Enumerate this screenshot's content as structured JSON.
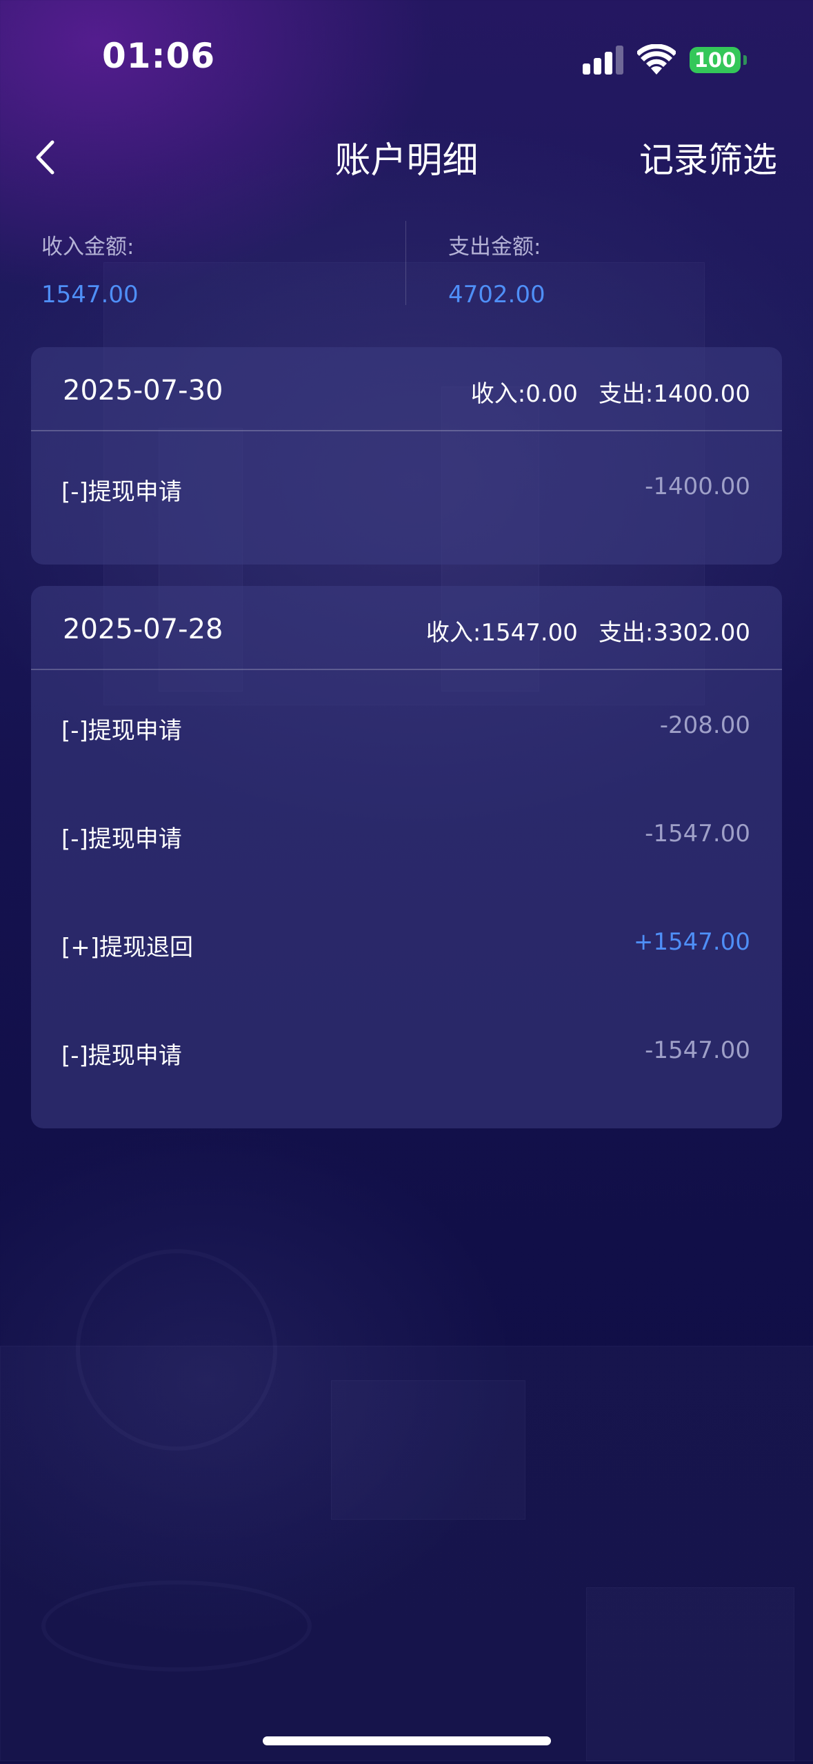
{
  "status_bar": {
    "time": "01:06",
    "battery": "100",
    "icons": [
      "cellular-signal-icon",
      "wifi-icon",
      "battery-icon"
    ]
  },
  "nav": {
    "back_icon": "chevron-left-icon",
    "title": "账户明细",
    "filter_label": "记录筛选"
  },
  "summary": {
    "income_label": "收入金额:",
    "income_value": "1547.00",
    "expense_label": "支出金额:",
    "expense_value": "4702.00"
  },
  "days": [
    {
      "date": "2025-07-30",
      "income": "收入:0.00",
      "expense": "支出:1400.00",
      "transactions": [
        {
          "label": "[-]提现申请",
          "amount": "-1400.00"
        }
      ]
    },
    {
      "date": "2025-07-28",
      "income": "收入:1547.00",
      "expense": "支出:3302.00",
      "transactions": [
        {
          "label": "[-]提现申请",
          "amount": "-208.00"
        },
        {
          "label": "[-]提现申请",
          "amount": "-1547.00"
        },
        {
          "label": "[+]提现退回",
          "amount": "+1547.00"
        },
        {
          "label": "[-]提现申请",
          "amount": "-1547.00"
        }
      ]
    }
  ],
  "colors": {
    "accent_blue": "#4f8ff7",
    "negative_amount": "#9fa0c8",
    "battery_green": "#34c759"
  }
}
